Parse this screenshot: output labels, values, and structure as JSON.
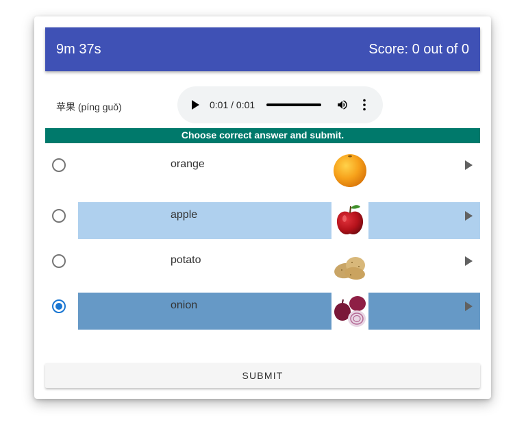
{
  "header": {
    "timer": "9m 37s",
    "score": "Score: 0 out of 0"
  },
  "prompt": {
    "word": "苹果 (píng guǒ)"
  },
  "audio_player": {
    "time": "0:01 / 0:01",
    "icons": [
      "play-icon",
      "volume-icon",
      "more-vert-icon"
    ]
  },
  "instruction": "Choose correct answer and submit.",
  "options": [
    {
      "label": "orange",
      "image": "orange-image",
      "selected": false,
      "highlight": null
    },
    {
      "label": "apple",
      "image": "apple-image",
      "selected": false,
      "highlight": "#afd0ee"
    },
    {
      "label": "potato",
      "image": "potato-image",
      "selected": false,
      "highlight": null
    },
    {
      "label": "onion",
      "image": "onion-image",
      "selected": true,
      "highlight": "#6699c6"
    }
  ],
  "submit_label": "SUBMIT",
  "colors": {
    "header_bg": "#3f51b5",
    "banner_bg": "#00796b",
    "radio_selected": "#1976d2",
    "highlight_light": "#afd0ee",
    "highlight_dark": "#6699c6"
  }
}
